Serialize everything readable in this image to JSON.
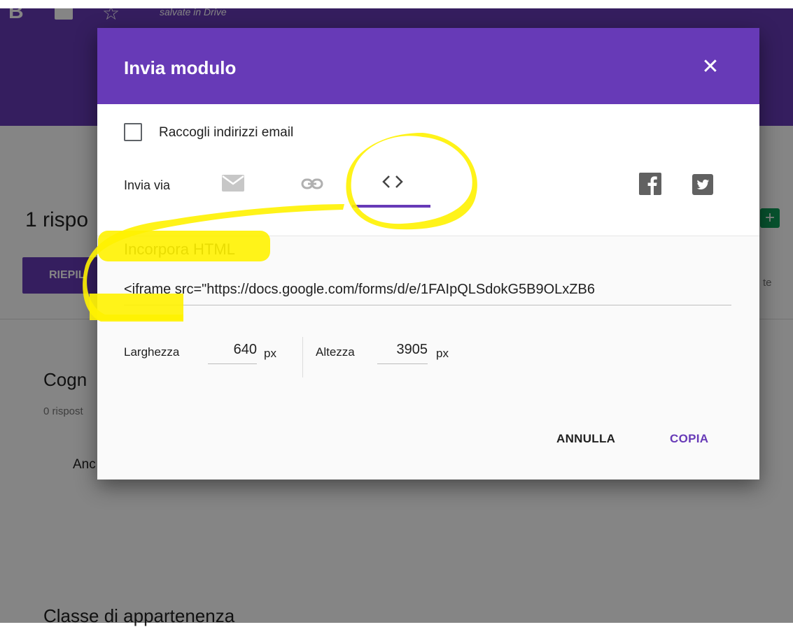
{
  "background": {
    "logo_letter": "B",
    "save_status": "salvate in Drive",
    "responses_title": "1 rispo",
    "summary_tab": "RIEPIL",
    "partial_text": "te",
    "question1_title": "Cogn",
    "question1_sub": "0 rispost",
    "question1_answer": "Anc",
    "question2_title": "Classe di appartenenza"
  },
  "dialog": {
    "title": "Invia modulo",
    "close_glyph": "✕",
    "collect_emails_label": "Raccogli indirizzi email",
    "send_via_label": "Invia via",
    "active_tab": "embed",
    "embed_title": "Incorpora HTML",
    "embed_code": "<iframe src=\"https://docs.google.com/forms/d/e/1FAIpQLSdokG5B9OLxZB6",
    "width_label": "Larghezza",
    "width_value": "640",
    "width_unit": "px",
    "height_label": "Altezza",
    "height_value": "3905",
    "height_unit": "px",
    "cancel_label": "ANNULLA",
    "copy_label": "COPIA"
  },
  "colors": {
    "accent": "#673ab7",
    "highlight": "#fff200"
  }
}
